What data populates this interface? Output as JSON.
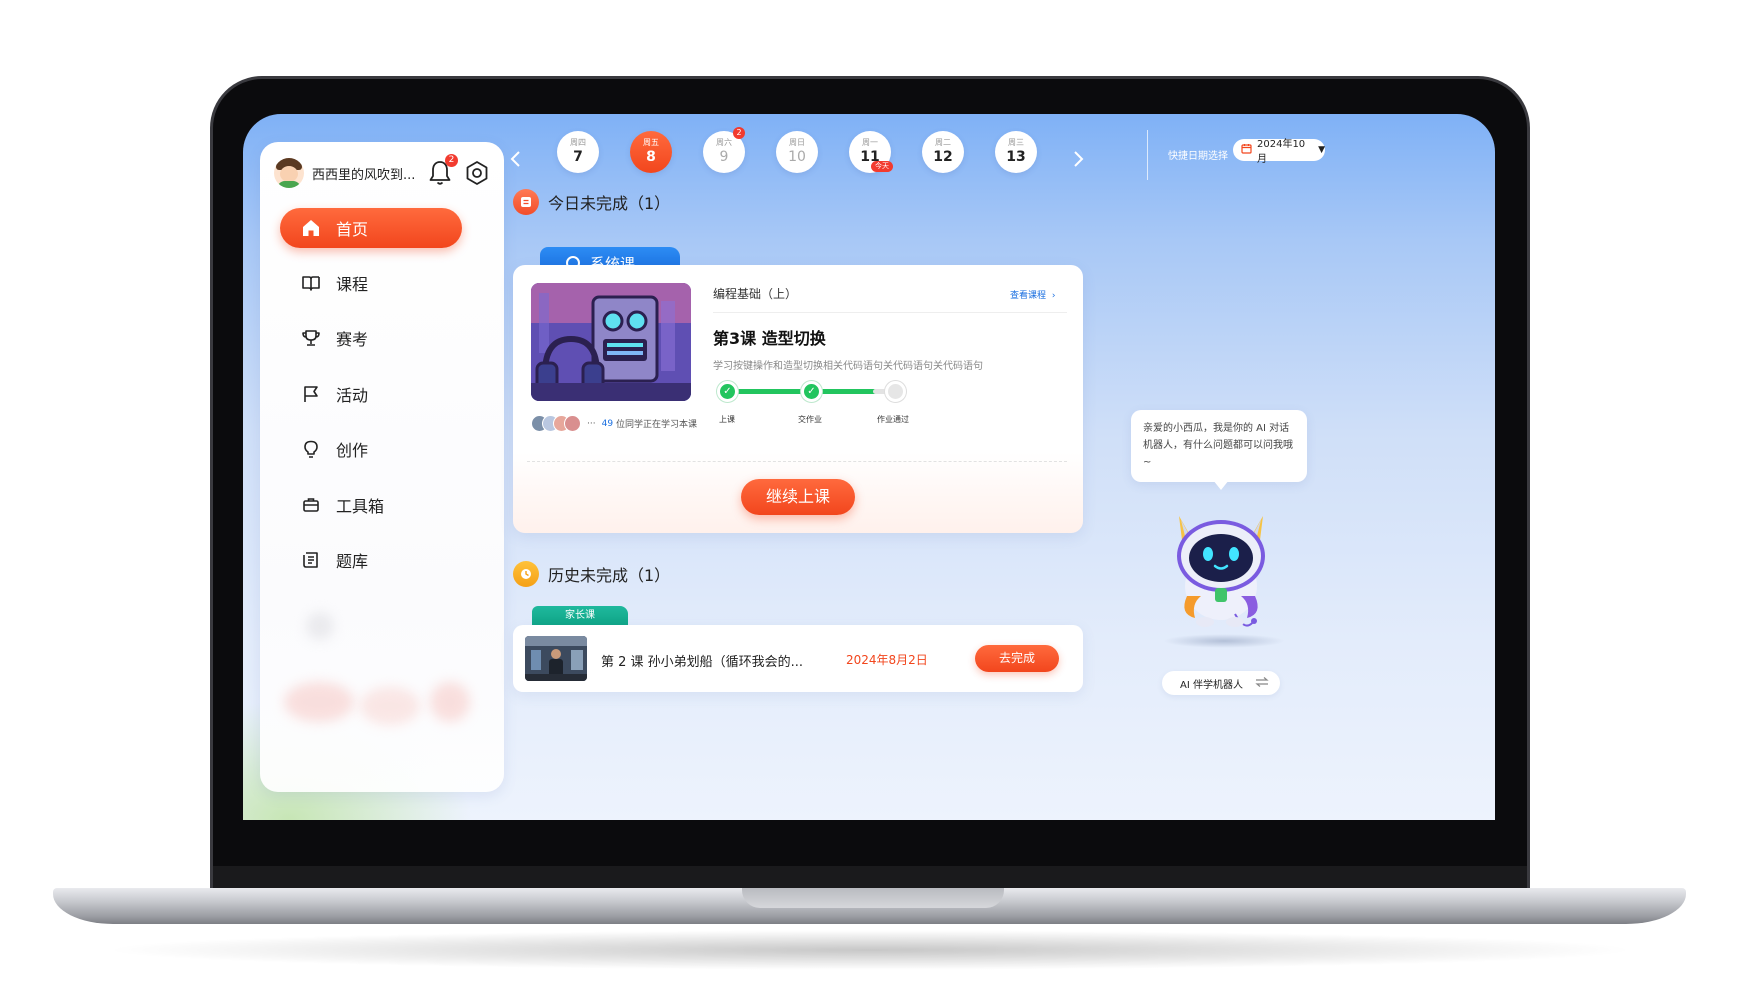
{
  "sidebar": {
    "profile_name": "西西里的风吹到...",
    "notification_count": "2",
    "items": [
      {
        "label": "首页",
        "icon": "home-icon",
        "active": true
      },
      {
        "label": "课程",
        "icon": "book-icon"
      },
      {
        "label": "赛考",
        "icon": "trophy-icon"
      },
      {
        "label": "活动",
        "icon": "flag-icon"
      },
      {
        "label": "创作",
        "icon": "lightbulb-icon"
      },
      {
        "label": "工具箱",
        "icon": "toolbox-icon"
      },
      {
        "label": "题库",
        "icon": "question-bank-icon"
      }
    ]
  },
  "date_bar": {
    "days": [
      {
        "weekday": "周四",
        "date": "7"
      },
      {
        "weekday": "周五",
        "date": "8",
        "selected": true
      },
      {
        "weekday": "周六",
        "date": "9",
        "badge": "2"
      },
      {
        "weekday": "周日",
        "date": "10"
      },
      {
        "weekday": "周一",
        "date": "11",
        "today_tag": "今天"
      },
      {
        "weekday": "周二",
        "date": "12"
      },
      {
        "weekday": "周三",
        "date": "13"
      }
    ],
    "quick_select_label": "快捷日期选择",
    "month_value": "2024年10月"
  },
  "today": {
    "heading": "今日未完成（1）",
    "tab_label": "系统课",
    "course_name": "编程基础（上）",
    "view_course_link": "查看课程",
    "lesson_title": "第3课   造型切换",
    "lesson_desc": "学习按键操作和造型切换相关代码语句关代码语句关代码语句",
    "steps": [
      "上课",
      "交作业",
      "作业通过"
    ],
    "learners_count": "49",
    "learners_text": "位同学正在学习本课",
    "continue_button": "继续上课"
  },
  "history": {
    "heading": "历史未完成（1）",
    "tab_label": "家长课",
    "lesson_title": "第 2 课   孙小弟划船（循环我会的...",
    "date": "2024年8月2日",
    "go_button": "去完成"
  },
  "robot": {
    "bubble_text": "亲爱的小西瓜，我是你的 AI 对话机器人，有什么问题都可以问我哦~",
    "switch_label": "AI 伴学机器人"
  },
  "colors": {
    "accent": "#f2461d",
    "progress_green": "#22c55e",
    "system_tab_blue": "#1768d9",
    "parent_tab_teal": "#0fa486"
  }
}
